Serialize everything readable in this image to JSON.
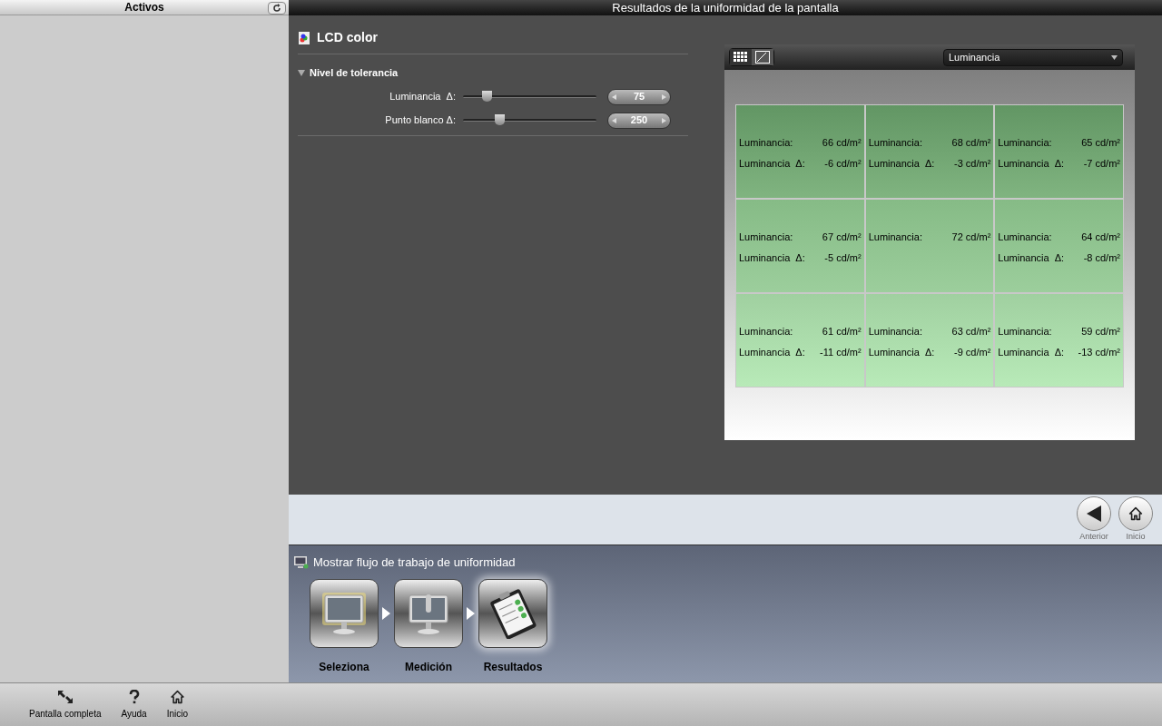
{
  "sidebar": {
    "title": "Activos"
  },
  "window": {
    "title": "Resultados de la uniformidad de la pantalla"
  },
  "device": {
    "name": "LCD color"
  },
  "tolerance": {
    "title": "Nivel de tolerancia",
    "expanded": true,
    "sliders": [
      {
        "label": "Luminancia  Δ:",
        "level": 0.18,
        "value": "75"
      },
      {
        "label": "Punto blanco Δ:",
        "level": 0.27,
        "value": "250"
      }
    ]
  },
  "view_toggle": [
    {
      "kind": "grid",
      "selected": true
    },
    {
      "kind": "curve",
      "selected": false
    }
  ],
  "measure_select": {
    "value": "Luminancia"
  },
  "grid_cells": [
    {
      "lines": [
        {
          "label": "Luminancia:",
          "value": "66 cd/m²"
        },
        {
          "label": "Luminancia  Δ:",
          "value": "-6 cd/m²"
        }
      ]
    },
    {
      "lines": [
        {
          "label": "Luminancia:",
          "value": "68 cd/m²"
        },
        {
          "label": "Luminancia  Δ:",
          "value": "-3 cd/m²"
        }
      ]
    },
    {
      "lines": [
        {
          "label": "Luminancia:",
          "value": "65 cd/m²"
        },
        {
          "label": "Luminancia  Δ:",
          "value": "-7 cd/m²"
        }
      ]
    },
    {
      "lines": [
        {
          "label": "Luminancia:",
          "value": "67 cd/m²"
        },
        {
          "label": "Luminancia  Δ:",
          "value": "-5 cd/m²"
        }
      ]
    },
    {
      "lines": [
        {
          "label": "Luminancia:",
          "value": "72 cd/m²"
        }
      ]
    },
    {
      "lines": [
        {
          "label": "Luminancia:",
          "value": "64 cd/m²"
        },
        {
          "label": "Luminancia  Δ:",
          "value": "-8 cd/m²"
        }
      ]
    },
    {
      "lines": [
        {
          "label": "Luminancia:",
          "value": "61 cd/m²"
        },
        {
          "label": "Luminancia  Δ:",
          "value": "-11 cd/m²"
        }
      ]
    },
    {
      "lines": [
        {
          "label": "Luminancia:",
          "value": "63 cd/m²"
        },
        {
          "label": "Luminancia  Δ:",
          "value": "-9 cd/m²"
        }
      ]
    },
    {
      "lines": [
        {
          "label": "Luminancia:",
          "value": "59 cd/m²"
        },
        {
          "label": "Luminancia  Δ:",
          "value": "-13 cd/m²"
        }
      ]
    }
  ],
  "nav_buttons": [
    {
      "kind": "back",
      "label": "Anterior"
    },
    {
      "kind": "home",
      "label": "Inicio"
    }
  ],
  "workflow": {
    "title": "Mostrar flujo de trabajo de uniformidad",
    "steps": [
      {
        "kind": "select",
        "label": "Seleziona",
        "selected": false
      },
      {
        "kind": "measure",
        "label": "Medición",
        "selected": false
      },
      {
        "kind": "results",
        "label": "Resultados",
        "selected": true
      }
    ]
  },
  "bottom_bar": [
    {
      "kind": "fullscreen",
      "label": "Pantalla completa"
    },
    {
      "kind": "help",
      "label": "Ayuda"
    },
    {
      "kind": "home",
      "label": "Inicio"
    }
  ]
}
